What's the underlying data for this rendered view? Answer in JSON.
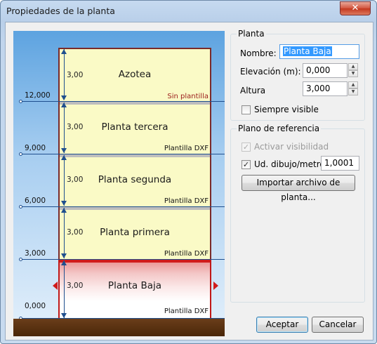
{
  "window": {
    "title": "Propiedades de la planta",
    "close_glyph": "✕"
  },
  "drawing": {
    "floors": [
      {
        "name": "Azotea",
        "height": "3,00",
        "template": "Sin plantilla",
        "selected": false
      },
      {
        "name": "Planta tercera",
        "height": "3,00",
        "template": "Plantilla DXF",
        "selected": false
      },
      {
        "name": "Planta segunda",
        "height": "3,00",
        "template": "Plantilla DXF",
        "selected": false
      },
      {
        "name": "Planta primera",
        "height": "3,00",
        "template": "Plantilla DXF",
        "selected": false
      },
      {
        "name": "Planta Baja",
        "height": "3,00",
        "template": "Plantilla DXF",
        "selected": true
      }
    ],
    "levels": [
      "12,000",
      "9,000",
      "6,000",
      "3,000",
      "0,000"
    ],
    "colors": {
      "selected": "#d01c1c",
      "dimension": "#1f4f8e",
      "ground": "#5a3210"
    }
  },
  "planta": {
    "group_title": "Planta",
    "nombre_label": "Nombre:",
    "nombre_value": "Planta Baja",
    "elevacion_label": "Elevación (m):",
    "elevacion_value": "0,000",
    "altura_label": "Altura",
    "altura_value": "3,000",
    "siempre_visible_label": "Siempre visible",
    "siempre_visible_checked": false
  },
  "plano": {
    "group_title": "Plano de referencia",
    "activar_label": "Activar visibilidad",
    "activar_checked": true,
    "ud_label": "Ud. dibujo/metro:",
    "ud_checked": true,
    "ud_value": "1,0001",
    "importar_label": "Importar archivo de planta..."
  },
  "buttons": {
    "aceptar": "Aceptar",
    "cancelar": "Cancelar"
  },
  "icons": {
    "check": "✓",
    "spin_up": "▲",
    "spin_down": "▼"
  }
}
